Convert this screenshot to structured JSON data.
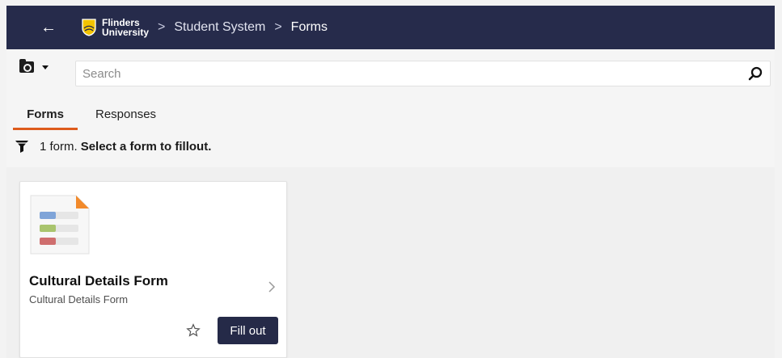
{
  "app": {
    "title": "Forms"
  },
  "topbar": {
    "back_icon": "arrow-left-icon",
    "logo_line1": "Flinders",
    "logo_line2": "University",
    "breadcrumbs": [
      {
        "label": "Student System"
      },
      {
        "label": "Forms"
      }
    ],
    "colors": {
      "background": "#262b4b"
    }
  },
  "toolbar": {
    "folder_icon": "folder-icon",
    "search": {
      "placeholder": "Search"
    },
    "search_icon": "search-icon"
  },
  "tabs": [
    {
      "label": "Forms",
      "active": true
    },
    {
      "label": "Responses",
      "active": false
    }
  ],
  "summary": {
    "icon": "funnel-icon",
    "count_text": "1 form.",
    "message": "Select a form to fillout."
  },
  "forms": [
    {
      "title": "Cultural Details Form",
      "subtitle": "Cultural Details Form",
      "thumb_icon": "form-document-icon",
      "favorite_icon": "star-icon",
      "action_label": "Fill out"
    }
  ],
  "colors": {
    "accent": "#dd5b1c",
    "button": "#252a48"
  }
}
